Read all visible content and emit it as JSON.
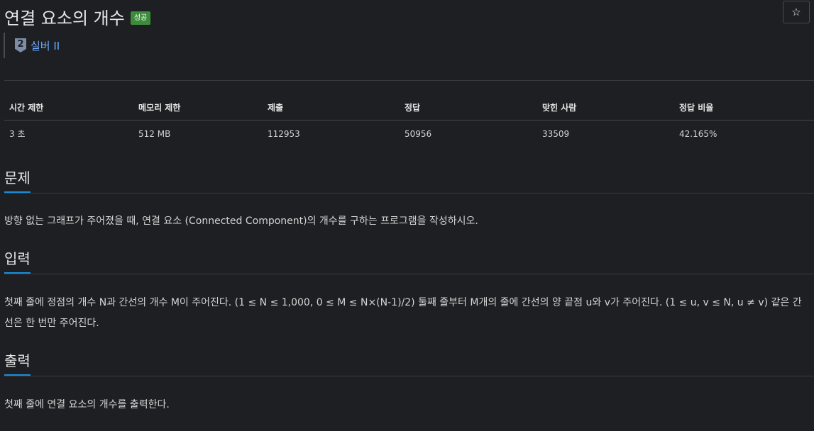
{
  "problem": {
    "title": "연결 요소의 개수",
    "status_badge": "성공",
    "star_icon": "☆",
    "tier_number": "2",
    "tier_label": "실버 II"
  },
  "limits": {
    "headers": [
      "시간 제한",
      "메모리 제한",
      "제출",
      "정답",
      "맞힌 사람",
      "정답 비율"
    ],
    "values": [
      "3 초",
      "512 MB",
      "112953",
      "50956",
      "33509",
      "42.165%"
    ]
  },
  "sections": {
    "problem": {
      "title": "문제",
      "text": "방향 없는 그래프가 주어졌을 때, 연결 요소 (Connected Component)의 개수를 구하는 프로그램을 작성하시오."
    },
    "input": {
      "title": "입력",
      "text": "첫째 줄에 정점의 개수 N과 간선의 개수 M이 주어진다. (1 ≤ N ≤ 1,000, 0 ≤ M ≤ N×(N-1)/2) 둘째 줄부터 M개의 줄에 간선의 양 끝점 u와 v가 주어진다. (1 ≤ u, v ≤ N, u ≠ v) 같은 간선은 한 번만 주어진다."
    },
    "output": {
      "title": "출력",
      "text": "첫째 줄에 연결 요소의 개수를 출력한다."
    }
  },
  "colors": {
    "background": "#1e1f22",
    "badge": "#3c8c3c",
    "link": "#6aa9ff",
    "section_underline": "#1a8cd8"
  }
}
